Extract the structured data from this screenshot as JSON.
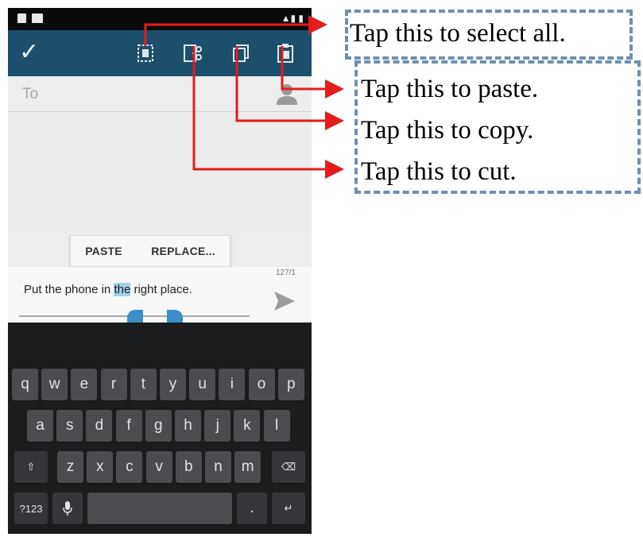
{
  "phone": {
    "to_label": "To",
    "popup": {
      "paste": "PASTE",
      "replace": "REPLACE..."
    },
    "compose": {
      "counter": "127/1",
      "message_before": "Put the phone in ",
      "message_selected": "the",
      "message_after": " right place."
    },
    "keyboard": {
      "row1": [
        "q",
        "w",
        "e",
        "r",
        "t",
        "y",
        "u",
        "i",
        "o",
        "p"
      ],
      "row2": [
        "a",
        "s",
        "d",
        "f",
        "g",
        "h",
        "j",
        "k",
        "l"
      ],
      "row3": [
        "z",
        "x",
        "c",
        "v",
        "b",
        "n",
        "m"
      ],
      "symbols": "?123",
      "period": "."
    }
  },
  "callouts": {
    "select_all": "Tap this to select all.",
    "paste": "Tap this to paste.",
    "copy": "Tap this to copy.",
    "cut": "Tap this to cut."
  },
  "colors": {
    "action_bar": "#1b4f6b",
    "arrow": "#e41c1c",
    "dash_border": "#6f8fae",
    "selection": "#9fd1e9"
  }
}
